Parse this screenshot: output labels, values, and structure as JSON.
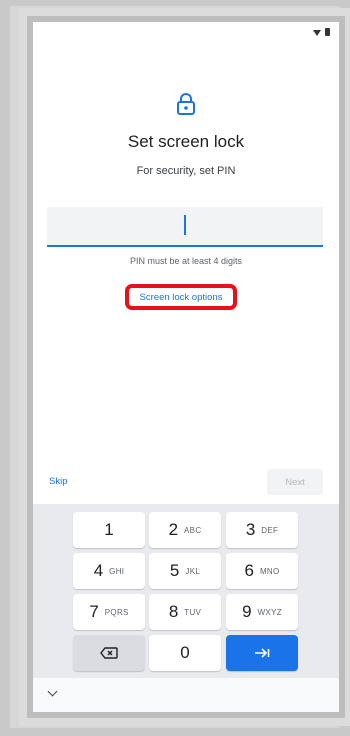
{
  "screen": {
    "title": "Set screen lock",
    "subtitle": "For security, set PIN",
    "pin_hint": "PIN must be at least 4 digits",
    "options_link": "Screen lock options",
    "skip_label": "Skip",
    "next_label": "Next"
  },
  "keypad": {
    "keys": [
      {
        "digit": "1",
        "letters": ""
      },
      {
        "digit": "2",
        "letters": "ABC"
      },
      {
        "digit": "3",
        "letters": "DEF"
      },
      {
        "digit": "4",
        "letters": "GHI"
      },
      {
        "digit": "5",
        "letters": "JKL"
      },
      {
        "digit": "6",
        "letters": "MNO"
      },
      {
        "digit": "7",
        "letters": "PQRS"
      },
      {
        "digit": "8",
        "letters": "TUV"
      },
      {
        "digit": "9",
        "letters": "WXYZ"
      },
      {
        "digit": "0",
        "letters": ""
      }
    ],
    "delete_icon": "backspace-icon",
    "enter_icon": "tab-next-icon"
  },
  "colors": {
    "accent": "#1a73e8",
    "highlight": "#e8101a"
  }
}
